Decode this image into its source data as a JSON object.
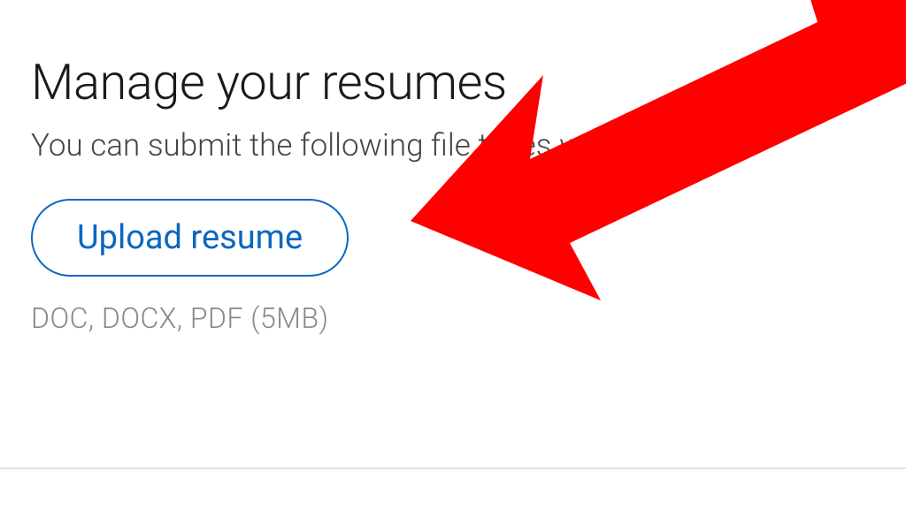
{
  "main": {
    "heading": "Manage your resumes",
    "subtitle": "You can submit the following file types with your",
    "upload_button_label": "Upload resume",
    "format_hint": "DOC, DOCX, PDF (5MB)"
  },
  "annotation": {
    "arrow_color": "#ff0000"
  }
}
